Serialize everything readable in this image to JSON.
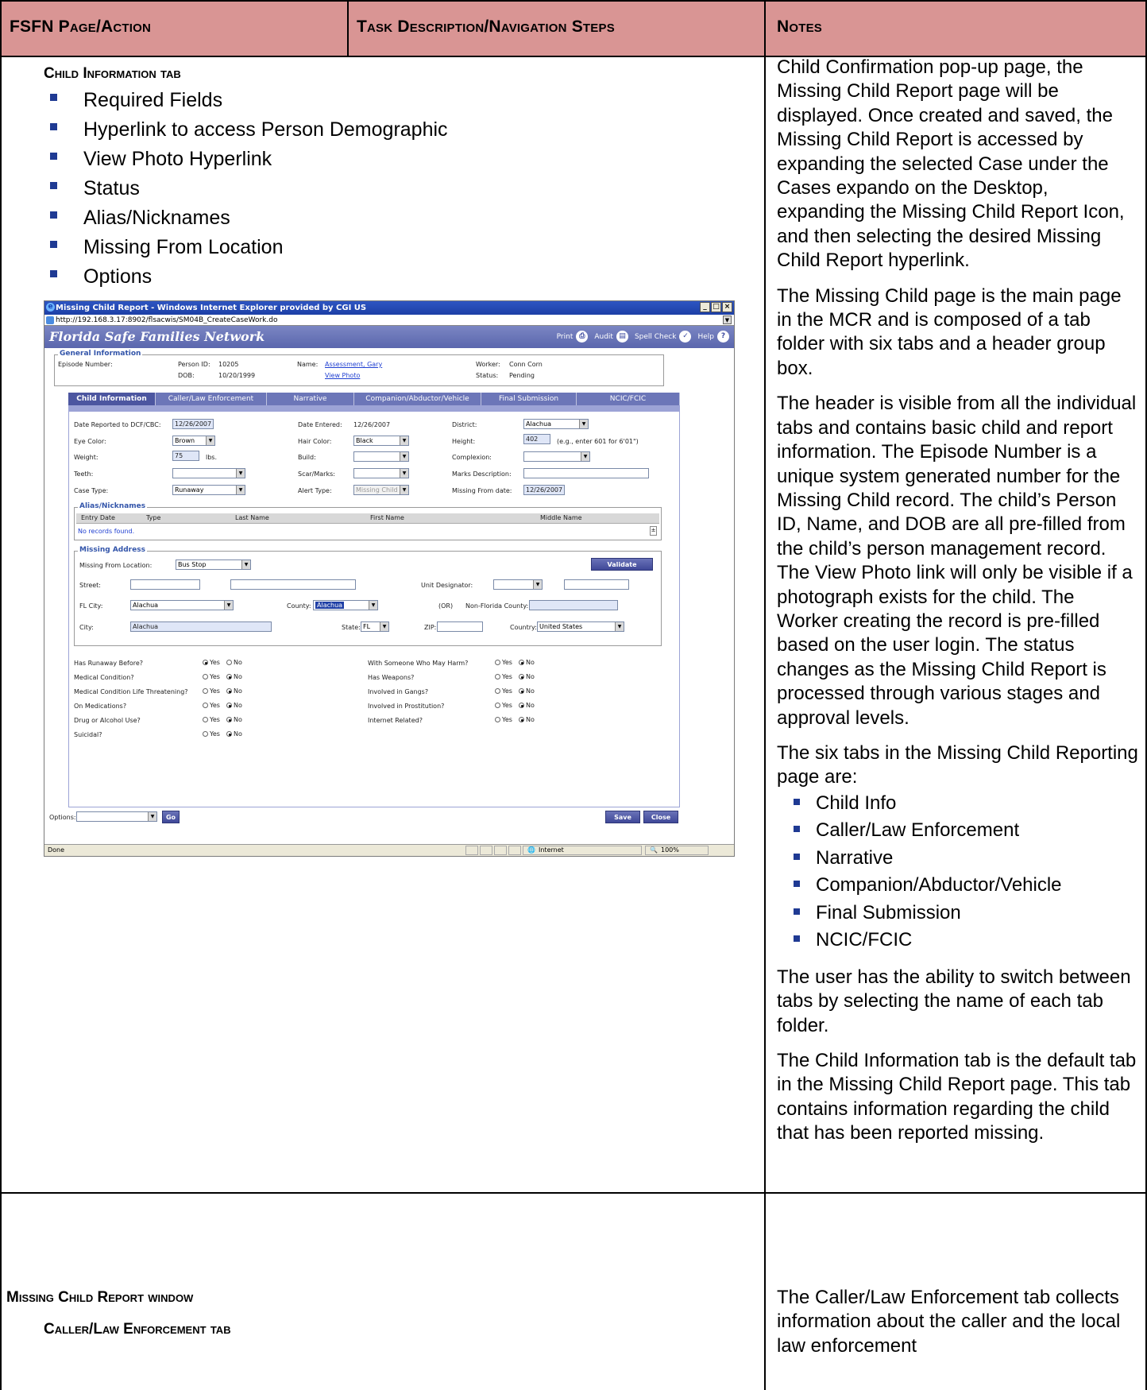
{
  "header": {
    "col1": "FSFN Page/Action",
    "col2": "Task Description/Navigation Steps",
    "col3": "Notes"
  },
  "row1": {
    "section_title": "Child Information tab",
    "bullets": [
      "Required Fields",
      "Hyperlink to access Person Demographic",
      "View Photo Hyperlink",
      "Status",
      "Alias/Nicknames",
      "Missing From Location",
      "Options"
    ],
    "notes": {
      "p1": "Child Confirmation pop-up page, the Missing Child Report page will be displayed. Once created and saved, the Missing Child Report is accessed by expanding the selected Case under the Cases expando on the Desktop, expanding the Missing Child Report Icon, and then selecting the desired Missing Child Report hyperlink.",
      "p2": "The Missing Child page is the main page in the MCR and is composed of a tab folder with six tabs and a header group box.",
      "p3": "The header is visible from all the individual tabs and contains basic child and report information. The Episode Number is a unique system generated number for the Missing Child record. The child’s Person ID, Name, and DOB are all pre-filled from the child’s person management record. The View Photo link will only be visible if a photograph exists for the child. The Worker creating the record is pre-filled based on the user login. The status changes as the Missing Child Report is processed through various stages and approval levels.",
      "p4": "The six tabs in the Missing Child Reporting page are:",
      "tabs_list": [
        "Child Info",
        "Caller/Law Enforcement",
        "Narrative",
        "Companion/Abductor/Vehicle",
        "Final Submission",
        "NCIC/FCIC"
      ],
      "p5": "The user has the ability to switch between tabs by selecting the name of each tab folder.",
      "p6": "The Child Information tab is the default tab in the Missing Child Report page. This tab contains information regarding the child that has been reported missing."
    }
  },
  "row2": {
    "section_title": "Missing Child Report window",
    "sub_title": "Caller/Law Enforcement tab",
    "notes": "The Caller/Law Enforcement tab collects information about the caller and the local law enforcement"
  },
  "screenshot": {
    "window_title": "Missing Child Report - Windows Internet Explorer provided by CGI US",
    "url": "http://192.168.3.17:8902/flsacwis/SM04B_CreateCaseWork.do",
    "brand": "Florida Safe Families Network",
    "tools": {
      "print": "Print",
      "audit": "Audit",
      "spell": "Spell Check",
      "help": "Help"
    },
    "general": {
      "legend": "General Information",
      "episode_label": "Episode Number:",
      "person_id_label": "Person ID:",
      "person_id": "10205",
      "dob_label": "DOB:",
      "dob": "10/20/1999",
      "name_label": "Name:",
      "name": "Assessment, Gary",
      "view_photo": "View Photo",
      "worker_label": "Worker:",
      "worker": "Conn Corn",
      "status_label": "Status:",
      "status": "Pending"
    },
    "tabs": [
      "Child Information",
      "Caller/Law Enforcement",
      "Narrative",
      "Companion/Abductor/Vehicle",
      "Final Submission",
      "NCIC/FCIC"
    ],
    "form": {
      "date_reported_label": "Date Reported to DCF/CBC:",
      "date_reported": "12/26/2007",
      "date_entered_label": "Date Entered:",
      "date_entered": "12/26/2007",
      "district_label": "District:",
      "district": "Alachua",
      "eye_label": "Eye Color:",
      "eye": "Brown",
      "hair_label": "Hair Color:",
      "hair": "Black",
      "height_label": "Height:",
      "height": "402",
      "height_hint": "(e.g., enter 601 for 6'01\")",
      "weight_label": "Weight:",
      "weight": "75",
      "weight_unit": "lbs.",
      "build_label": "Build:",
      "complexion_label": "Complexion:",
      "teeth_label": "Teeth:",
      "scar_label": "Scar/Marks:",
      "marks_desc_label": "Marks Description:",
      "case_type_label": "Case Type:",
      "case_type": "Runaway",
      "alert_label": "Alert Type:",
      "alert": "Missing Child",
      "missing_from_date_label": "Missing From date:",
      "missing_from_date": "12/26/2007"
    },
    "alias": {
      "legend": "Alias/Nicknames",
      "columns": [
        "Entry Date",
        "Type",
        "Last Name",
        "First Name",
        "Middle Name"
      ],
      "empty": "No records found."
    },
    "address": {
      "legend": "Missing Address",
      "location_label": "Missing From Location:",
      "location": "Bus Stop",
      "validate": "Validate",
      "street_label": "Street:",
      "unit_label": "Unit Designator:",
      "fl_city_label": "FL City:",
      "fl_city": "Alachua",
      "county_label": "County:",
      "county": "Alachua",
      "or_label": "(OR)",
      "nonfl_label": "Non-Florida County:",
      "city_label": "City:",
      "city": "Alachua",
      "state_label": "State:",
      "state": "FL",
      "zip_label": "ZIP:",
      "country_label": "Country:",
      "country": "United States"
    },
    "questions_left": [
      {
        "q": "Has Runaway Before?",
        "answer": "Yes"
      },
      {
        "q": "Medical Condition?",
        "answer": "No"
      },
      {
        "q": "Medical Condition Life Threatening?",
        "answer": "No"
      },
      {
        "q": "On Medications?",
        "answer": "No"
      },
      {
        "q": "Drug or Alcohol Use?",
        "answer": "No"
      },
      {
        "q": "Suicidal?",
        "answer": "No"
      }
    ],
    "questions_right": [
      {
        "q": "With Someone Who May Harm?",
        "answer": "No"
      },
      {
        "q": "Has Weapons?",
        "answer": "No"
      },
      {
        "q": "Involved in Gangs?",
        "answer": "No"
      },
      {
        "q": "Involved in Prostitution?",
        "answer": "No"
      },
      {
        "q": "Internet Related?",
        "answer": "No"
      }
    ],
    "yes": "Yes",
    "no": "No",
    "options_label": "Options:",
    "go": "Go",
    "save": "Save",
    "close": "Close",
    "status_done": "Done",
    "zone": "Internet",
    "zoom": "100%"
  }
}
